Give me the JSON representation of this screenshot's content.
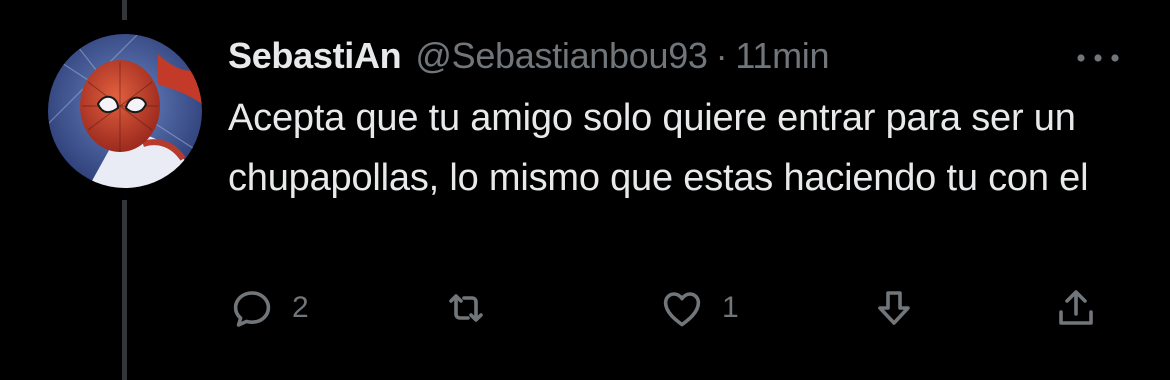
{
  "tweet": {
    "display_name": "SebastiAn",
    "handle": "@Sebastianbou93",
    "separator": "·",
    "time": "11min",
    "text": "Acepta que tu amigo solo quiere entrar para ser un chupapollas, lo mismo que estas haciendo tu con el"
  },
  "actions": {
    "reply": {
      "icon": "reply-icon",
      "count": "2"
    },
    "retweet": {
      "icon": "retweet-icon",
      "count": ""
    },
    "like": {
      "icon": "heart-icon",
      "count": "1"
    },
    "save": {
      "icon": "arrow-down-icon"
    },
    "share": {
      "icon": "share-icon"
    }
  },
  "colors": {
    "background": "#000000",
    "text_primary": "#e7e9ea",
    "text_secondary": "#71767b",
    "thread_line": "#333639"
  }
}
